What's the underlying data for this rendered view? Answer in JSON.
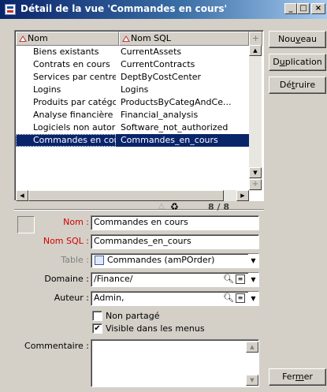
{
  "window": {
    "title": "Détail de la vue 'Commandes en cours'",
    "min_glyph": "_",
    "max_glyph": "□",
    "close_glyph": "×"
  },
  "list": {
    "columns": [
      "Nom",
      "Nom SQL"
    ],
    "header_plus": "+",
    "rows": [
      {
        "name": "Biens existants",
        "sql": "CurrentAssets"
      },
      {
        "name": "Contrats en cours",
        "sql": "CurrentContracts"
      },
      {
        "name": "Services par centre ...",
        "sql": "DeptByCostCenter"
      },
      {
        "name": "Logins",
        "sql": "Logins"
      },
      {
        "name": "Produits par catégori...",
        "sql": "ProductsByCategAndCe..."
      },
      {
        "name": "Analyse financière",
        "sql": "Financial_analysis"
      },
      {
        "name": "Logiciels non autoris...",
        "sql": "Software_not_authorized"
      },
      {
        "name": "Commandes en cours",
        "sql": "Commandes_en_cours"
      }
    ],
    "selected_index": 7,
    "counter": "8 / 8"
  },
  "buttons": {
    "new": {
      "pre": "Nou",
      "u": "v",
      "post": "eau"
    },
    "duplicate": {
      "pre": "D",
      "u": "u",
      "post": "plication"
    },
    "delete": {
      "pre": "Dé",
      "u": "t",
      "post": "ruire"
    },
    "close": {
      "pre": "Fer",
      "u": "m",
      "post": "er"
    }
  },
  "form": {
    "name_label": "Nom :",
    "name_value": "Commandes en cours",
    "sql_label": "Nom SQL :",
    "sql_value": "Commandes_en_cours",
    "table_label": "Table :",
    "table_value": "Commandes (amPOrder)",
    "domain_label": "Domaine :",
    "domain_value": "/Finance/",
    "author_label": "Auteur :",
    "author_value": "Admin,",
    "not_shared_label": "Non partagé",
    "not_shared_checked": false,
    "visible_menus_label": "Visible dans les menus",
    "visible_menus_checked": true,
    "check_glyph": "✔",
    "comment_label": "Commentaire :",
    "comment_value": ""
  },
  "colors": {
    "selection": "#0a246a",
    "required_label": "#d00000",
    "disabled_label": "#808080"
  }
}
